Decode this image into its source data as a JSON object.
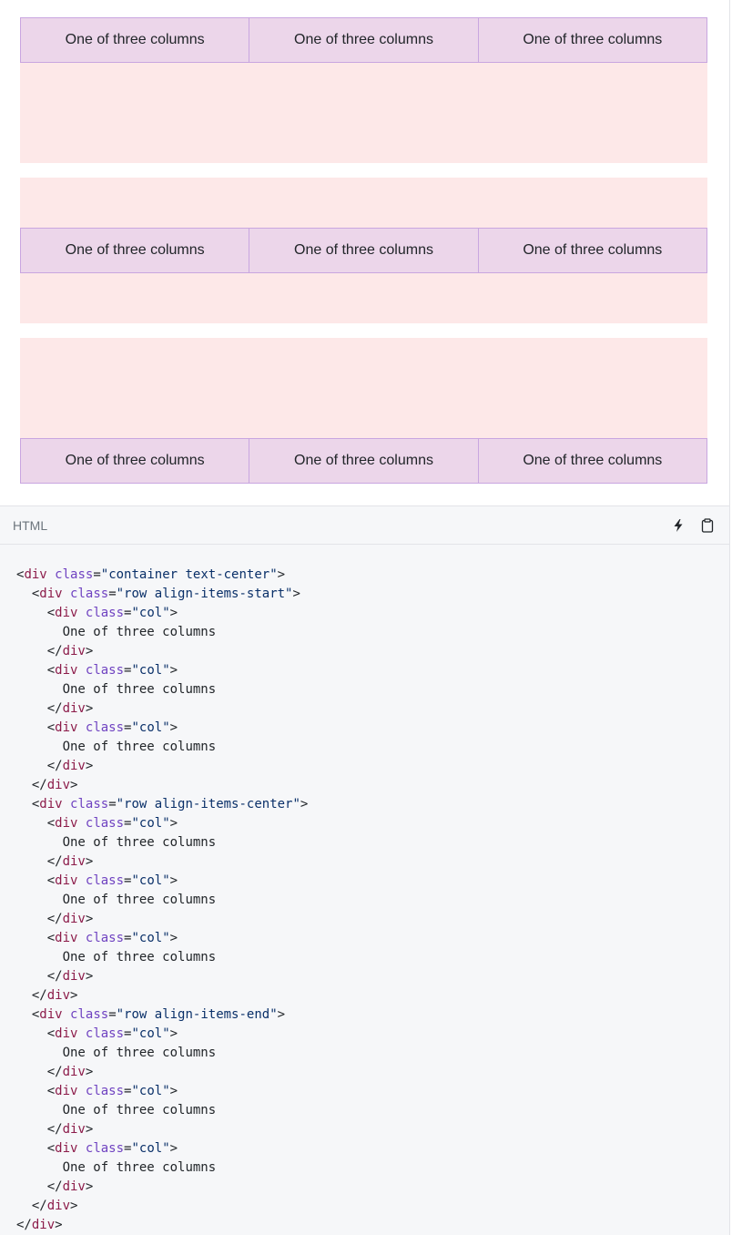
{
  "example": {
    "rows": [
      {
        "align": "start",
        "cols": [
          "One of three columns",
          "One of three columns",
          "One of three columns"
        ]
      },
      {
        "align": "center",
        "cols": [
          "One of three columns",
          "One of three columns",
          "One of three columns"
        ]
      },
      {
        "align": "end",
        "cols": [
          "One of three columns",
          "One of three columns",
          "One of three columns"
        ]
      }
    ]
  },
  "code_panel": {
    "language_label": "HTML",
    "icons": [
      "lightning-icon",
      "clipboard-icon"
    ],
    "lines": [
      [
        [
          "p",
          "<"
        ],
        [
          "t",
          "div"
        ],
        [
          "s",
          " "
        ],
        [
          "a",
          "class"
        ],
        [
          "p",
          "="
        ],
        [
          "v",
          "\"container text-center\""
        ],
        [
          "p",
          ">"
        ]
      ],
      [
        [
          "s",
          "  "
        ],
        [
          "p",
          "<"
        ],
        [
          "t",
          "div"
        ],
        [
          "s",
          " "
        ],
        [
          "a",
          "class"
        ],
        [
          "p",
          "="
        ],
        [
          "v",
          "\"row align-items-start\""
        ],
        [
          "p",
          ">"
        ]
      ],
      [
        [
          "s",
          "    "
        ],
        [
          "p",
          "<"
        ],
        [
          "t",
          "div"
        ],
        [
          "s",
          " "
        ],
        [
          "a",
          "class"
        ],
        [
          "p",
          "="
        ],
        [
          "v",
          "\"col\""
        ],
        [
          "p",
          ">"
        ]
      ],
      [
        [
          "s",
          "      "
        ],
        [
          "p",
          "One of three columns"
        ]
      ],
      [
        [
          "s",
          "    "
        ],
        [
          "p",
          "</"
        ],
        [
          "t",
          "div"
        ],
        [
          "p",
          ">"
        ]
      ],
      [
        [
          "s",
          "    "
        ],
        [
          "p",
          "<"
        ],
        [
          "t",
          "div"
        ],
        [
          "s",
          " "
        ],
        [
          "a",
          "class"
        ],
        [
          "p",
          "="
        ],
        [
          "v",
          "\"col\""
        ],
        [
          "p",
          ">"
        ]
      ],
      [
        [
          "s",
          "      "
        ],
        [
          "p",
          "One of three columns"
        ]
      ],
      [
        [
          "s",
          "    "
        ],
        [
          "p",
          "</"
        ],
        [
          "t",
          "div"
        ],
        [
          "p",
          ">"
        ]
      ],
      [
        [
          "s",
          "    "
        ],
        [
          "p",
          "<"
        ],
        [
          "t",
          "div"
        ],
        [
          "s",
          " "
        ],
        [
          "a",
          "class"
        ],
        [
          "p",
          "="
        ],
        [
          "v",
          "\"col\""
        ],
        [
          "p",
          ">"
        ]
      ],
      [
        [
          "s",
          "      "
        ],
        [
          "p",
          "One of three columns"
        ]
      ],
      [
        [
          "s",
          "    "
        ],
        [
          "p",
          "</"
        ],
        [
          "t",
          "div"
        ],
        [
          "p",
          ">"
        ]
      ],
      [
        [
          "s",
          "  "
        ],
        [
          "p",
          "</"
        ],
        [
          "t",
          "div"
        ],
        [
          "p",
          ">"
        ]
      ],
      [
        [
          "s",
          "  "
        ],
        [
          "p",
          "<"
        ],
        [
          "t",
          "div"
        ],
        [
          "s",
          " "
        ],
        [
          "a",
          "class"
        ],
        [
          "p",
          "="
        ],
        [
          "v",
          "\"row align-items-center\""
        ],
        [
          "p",
          ">"
        ]
      ],
      [
        [
          "s",
          "    "
        ],
        [
          "p",
          "<"
        ],
        [
          "t",
          "div"
        ],
        [
          "s",
          " "
        ],
        [
          "a",
          "class"
        ],
        [
          "p",
          "="
        ],
        [
          "v",
          "\"col\""
        ],
        [
          "p",
          ">"
        ]
      ],
      [
        [
          "s",
          "      "
        ],
        [
          "p",
          "One of three columns"
        ]
      ],
      [
        [
          "s",
          "    "
        ],
        [
          "p",
          "</"
        ],
        [
          "t",
          "div"
        ],
        [
          "p",
          ">"
        ]
      ],
      [
        [
          "s",
          "    "
        ],
        [
          "p",
          "<"
        ],
        [
          "t",
          "div"
        ],
        [
          "s",
          " "
        ],
        [
          "a",
          "class"
        ],
        [
          "p",
          "="
        ],
        [
          "v",
          "\"col\""
        ],
        [
          "p",
          ">"
        ]
      ],
      [
        [
          "s",
          "      "
        ],
        [
          "p",
          "One of three columns"
        ]
      ],
      [
        [
          "s",
          "    "
        ],
        [
          "p",
          "</"
        ],
        [
          "t",
          "div"
        ],
        [
          "p",
          ">"
        ]
      ],
      [
        [
          "s",
          "    "
        ],
        [
          "p",
          "<"
        ],
        [
          "t",
          "div"
        ],
        [
          "s",
          " "
        ],
        [
          "a",
          "class"
        ],
        [
          "p",
          "="
        ],
        [
          "v",
          "\"col\""
        ],
        [
          "p",
          ">"
        ]
      ],
      [
        [
          "s",
          "      "
        ],
        [
          "p",
          "One of three columns"
        ]
      ],
      [
        [
          "s",
          "    "
        ],
        [
          "p",
          "</"
        ],
        [
          "t",
          "div"
        ],
        [
          "p",
          ">"
        ]
      ],
      [
        [
          "s",
          "  "
        ],
        [
          "p",
          "</"
        ],
        [
          "t",
          "div"
        ],
        [
          "p",
          ">"
        ]
      ],
      [
        [
          "s",
          "  "
        ],
        [
          "p",
          "<"
        ],
        [
          "t",
          "div"
        ],
        [
          "s",
          " "
        ],
        [
          "a",
          "class"
        ],
        [
          "p",
          "="
        ],
        [
          "v",
          "\"row align-items-end\""
        ],
        [
          "p",
          ">"
        ]
      ],
      [
        [
          "s",
          "    "
        ],
        [
          "p",
          "<"
        ],
        [
          "t",
          "div"
        ],
        [
          "s",
          " "
        ],
        [
          "a",
          "class"
        ],
        [
          "p",
          "="
        ],
        [
          "v",
          "\"col\""
        ],
        [
          "p",
          ">"
        ]
      ],
      [
        [
          "s",
          "      "
        ],
        [
          "p",
          "One of three columns"
        ]
      ],
      [
        [
          "s",
          "    "
        ],
        [
          "p",
          "</"
        ],
        [
          "t",
          "div"
        ],
        [
          "p",
          ">"
        ]
      ],
      [
        [
          "s",
          "    "
        ],
        [
          "p",
          "<"
        ],
        [
          "t",
          "div"
        ],
        [
          "s",
          " "
        ],
        [
          "a",
          "class"
        ],
        [
          "p",
          "="
        ],
        [
          "v",
          "\"col\""
        ],
        [
          "p",
          ">"
        ]
      ],
      [
        [
          "s",
          "      "
        ],
        [
          "p",
          "One of three columns"
        ]
      ],
      [
        [
          "s",
          "    "
        ],
        [
          "p",
          "</"
        ],
        [
          "t",
          "div"
        ],
        [
          "p",
          ">"
        ]
      ],
      [
        [
          "s",
          "    "
        ],
        [
          "p",
          "<"
        ],
        [
          "t",
          "div"
        ],
        [
          "s",
          " "
        ],
        [
          "a",
          "class"
        ],
        [
          "p",
          "="
        ],
        [
          "v",
          "\"col\""
        ],
        [
          "p",
          ">"
        ]
      ],
      [
        [
          "s",
          "      "
        ],
        [
          "p",
          "One of three columns"
        ]
      ],
      [
        [
          "s",
          "    "
        ],
        [
          "p",
          "</"
        ],
        [
          "t",
          "div"
        ],
        [
          "p",
          ">"
        ]
      ],
      [
        [
          "s",
          "  "
        ],
        [
          "p",
          "</"
        ],
        [
          "t",
          "div"
        ],
        [
          "p",
          ">"
        ]
      ],
      [
        [
          "p",
          "</"
        ],
        [
          "t",
          "div"
        ],
        [
          "p",
          ">"
        ]
      ]
    ]
  },
  "colors": {
    "row_background": "#fde8e8",
    "col_background": "#ecd6ea",
    "col_border": "#c9a6e0",
    "code_background": "#f6f7f9",
    "tag_color": "#8c1c4a",
    "attr_color": "#6f42c1",
    "string_color": "#0a3069"
  }
}
